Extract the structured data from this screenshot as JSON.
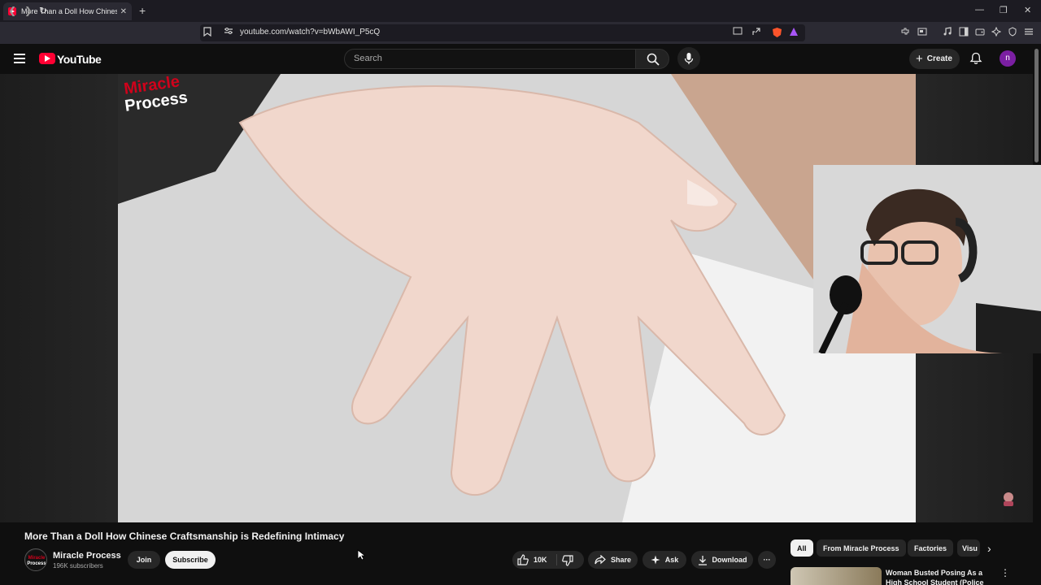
{
  "browser": {
    "tab_title": "More Than a Doll How Chinese Craftsmanship is Redefining Intimacy",
    "new_tab_symbol": "+",
    "tab_close": "✕",
    "url": "youtube.com/watch?v=bWbAWI_P5cQ",
    "window_controls": [
      "—",
      "❐",
      "✕"
    ]
  },
  "masthead": {
    "logo_text": "YouTube",
    "search_placeholder": "Search",
    "create_label": "Create",
    "create_symbol": "+",
    "avatar_letter": "n"
  },
  "player": {
    "watermark_line1": "Miracle",
    "watermark_line2": "Process"
  },
  "video": {
    "title": "More Than a Doll How Chinese Craftsmanship is Redefining Intimacy",
    "channel_name": "Miracle Process",
    "subscribers": "196K subscribers",
    "join_label": "Join",
    "subscribe_label": "Subscribe",
    "likes": "10K",
    "share_label": "Share",
    "ask_label": "Ask",
    "download_label": "Download",
    "more_symbol": "···"
  },
  "sidebar": {
    "chips": [
      "All",
      "From Miracle Process",
      "Factories",
      "Visu"
    ],
    "next_symbol": "›",
    "rec_title": "Woman Busted Posing As a High School Student (Police",
    "rec_more": "⋮"
  },
  "colors": {
    "youtube_red": "#ff0033",
    "background": "#0f0f0f",
    "avatar": "#7b1fa2"
  }
}
